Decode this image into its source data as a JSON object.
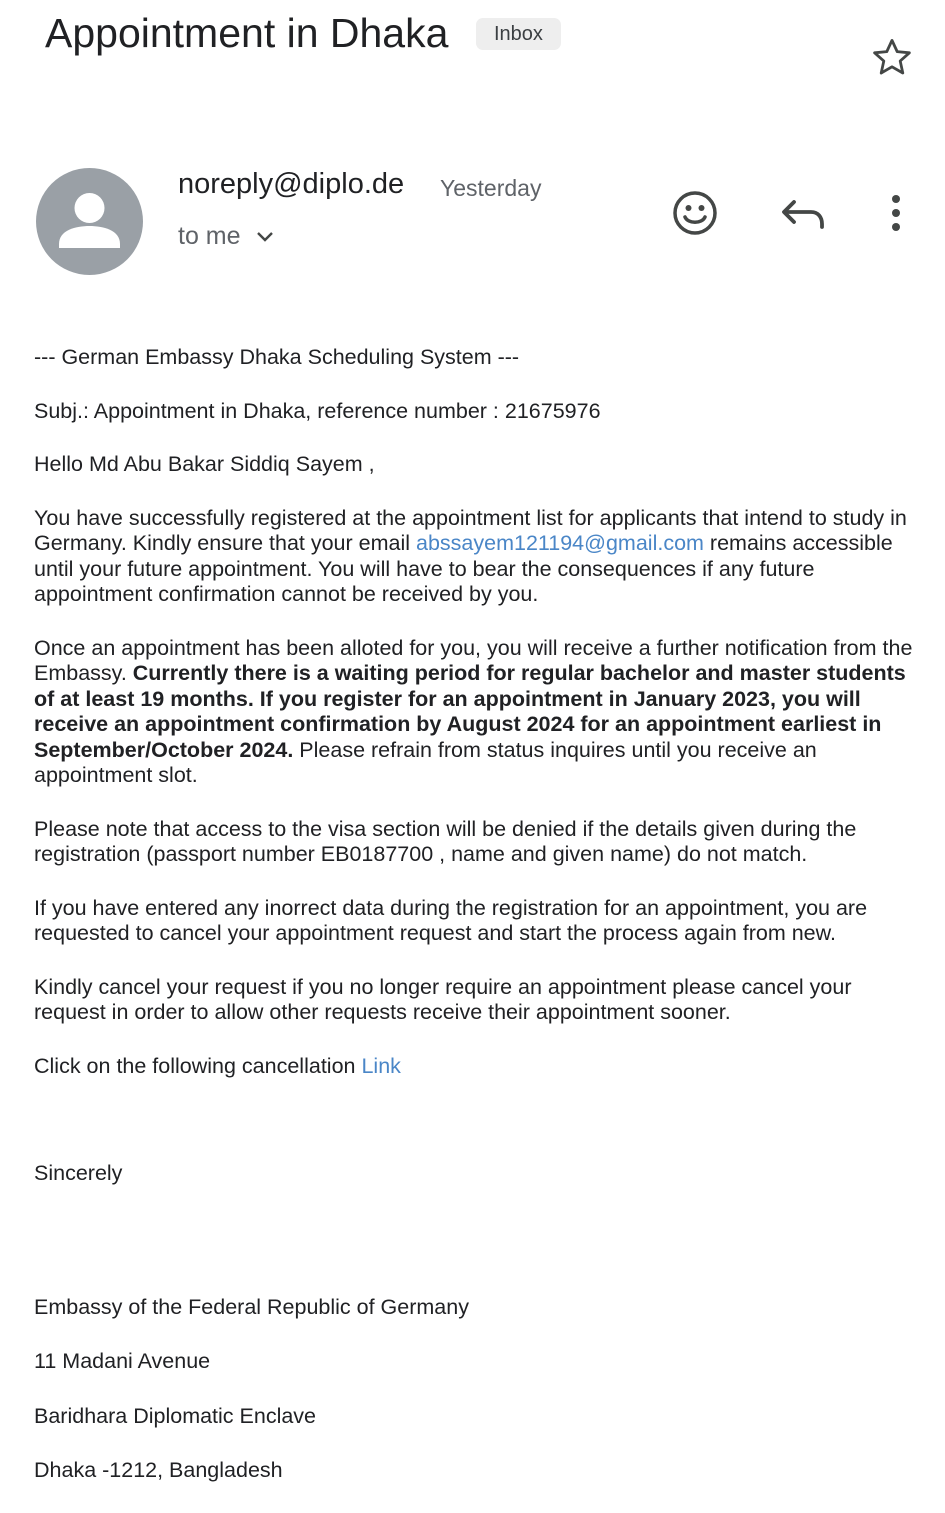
{
  "header": {
    "subject": "Appointment in Dhaka",
    "label": "Inbox"
  },
  "message": {
    "sender": "noreply@diplo.de",
    "date": "Yesterday",
    "recipient": "to me",
    "avatar_color": "#9aa0a6"
  },
  "icons": {
    "star": "star-icon",
    "emoji": "emoji-icon",
    "reply": "reply-icon",
    "more": "more-vert-icon",
    "expand": "chevron-down-icon"
  },
  "body": {
    "system_line": "--- German Embassy Dhaka Scheduling System ---",
    "subj_line": "Subj.: Appointment in  Dhaka, reference number : 21675976",
    "greeting": "Hello Md Abu Bakar Siddiq Sayem ,",
    "para1_a": "You have successfully registered at the appointment list for applicants that intend to study in Germany. Kindly ensure that your email ",
    "para1_email": "abssayem121194@gmail.com",
    "para1_b": " remains accessible until your future appointment. You will have to bear the consequences if any future appointment confirmation cannot be received by you.",
    "para2_a": "Once an appointment has been alloted for you, you will receive a further notification from the Embassy. ",
    "para2_bold": "Currently there is a waiting period for regular bachelor and master students of at least 19 months. If you register for an appointment in January 2023, you will receive an appointment confirmation by August 2024 for an appointment earliest in September/October 2024.",
    "para2_b": " Please refrain from status inquires until you receive an appointment slot.",
    "para3": "Please note that access to the visa section will be denied if the details given during the registration (passport number EB0187700 , name and given name) do not match.",
    "para4": "If you have entered any inorrect data during the registration for an appointment, you are requested to cancel your appointment request and start the process again from new.",
    "para5": "Kindly cancel your request if you no longer require an appointment please cancel your request in order to allow other requests receive their appointment sooner.",
    "cancel_text": "Click on the following cancellation ",
    "cancel_link": "Link",
    "closing": "Sincerely",
    "sig_org": "Embassy of the Federal Republic of Germany",
    "sig_addr1": "11 Madani Avenue",
    "sig_addr2": "Baridhara Diplomatic Enclave",
    "sig_addr3": "Dhaka -1212, Bangladesh",
    "link_color": "#4a86c7"
  }
}
